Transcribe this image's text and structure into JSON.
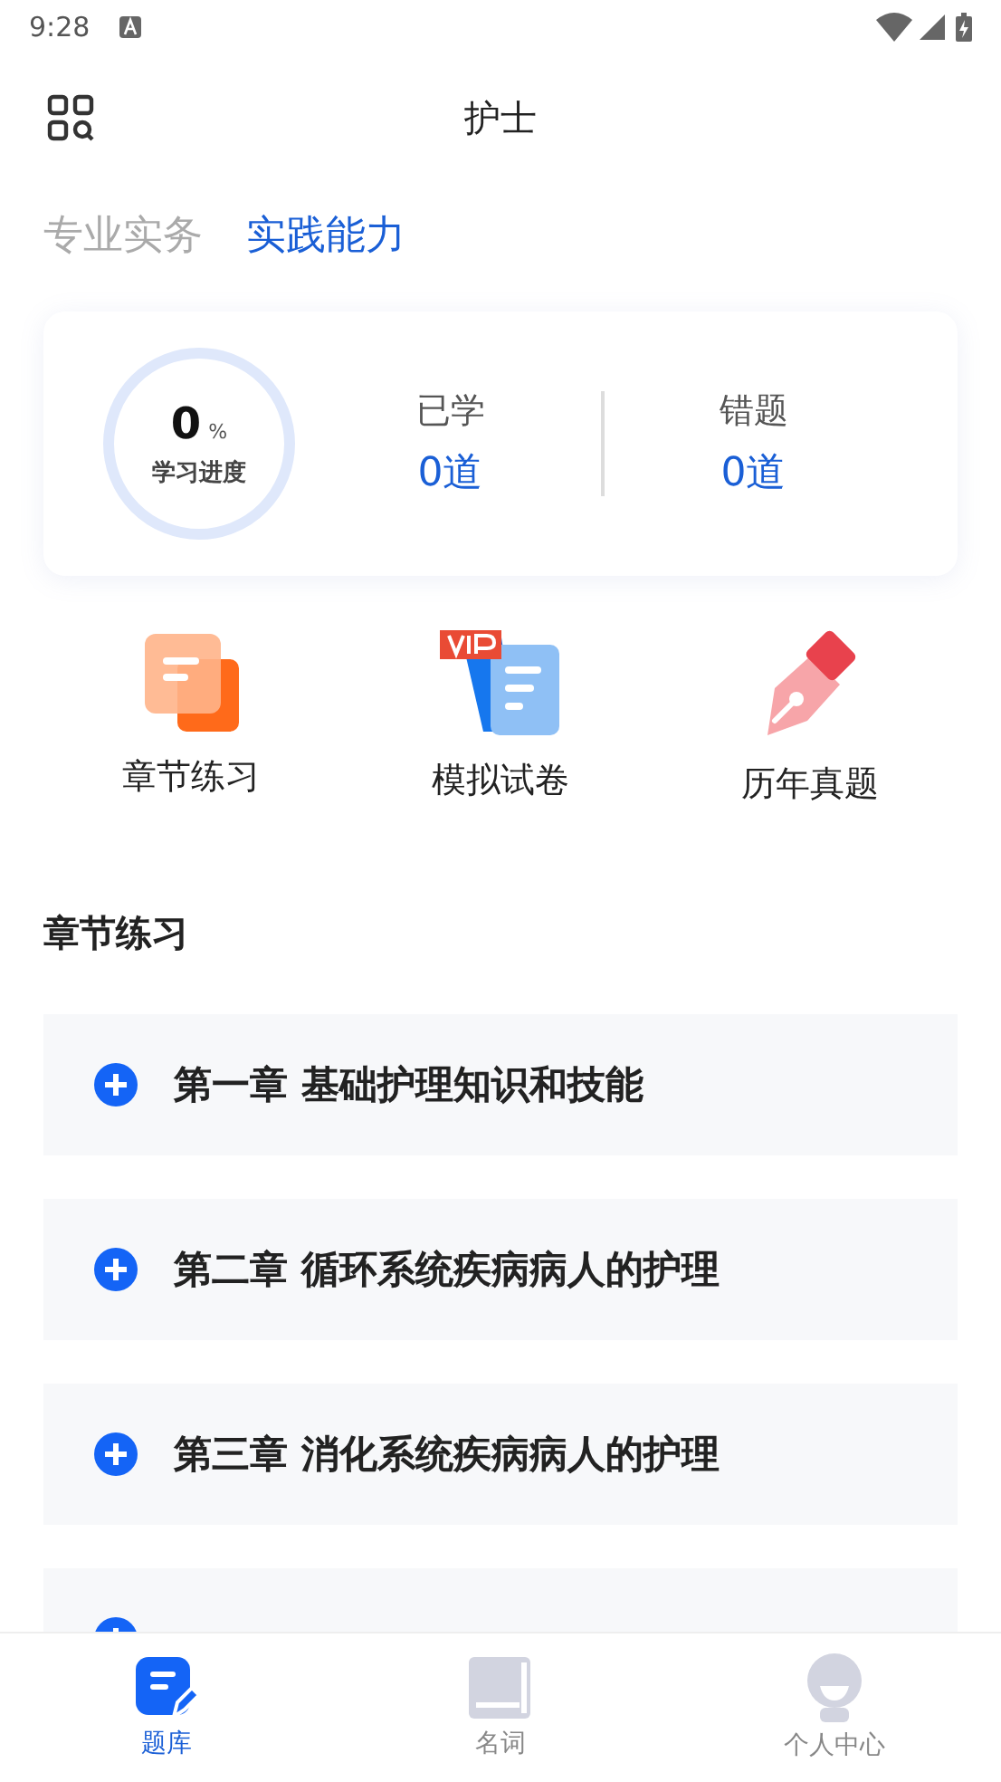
{
  "status_bar": {
    "time": "9:28"
  },
  "header": {
    "title": "护士"
  },
  "tabs": [
    {
      "label": "专业实务",
      "selected": false
    },
    {
      "label": "实践能力",
      "selected": true
    }
  ],
  "progress": {
    "value": "0",
    "unit": "%",
    "label": "学习进度"
  },
  "stats": [
    {
      "label": "已学",
      "value": "0道"
    },
    {
      "label": "错题",
      "value": "0道"
    }
  ],
  "shortcuts": [
    {
      "kind": "chapter",
      "label": "章节练习"
    },
    {
      "kind": "mock",
      "label": "模拟试卷"
    },
    {
      "kind": "past",
      "label": "历年真题"
    }
  ],
  "section_title": "章节练习",
  "chapters": [
    {
      "kind": "chapter",
      "title": "第一章 基础护理知识和技能"
    },
    {
      "kind": "chapter",
      "title": "第二章 循环系统疾病病人的护理"
    },
    {
      "kind": "chapter",
      "title": "第三章 消化系统疾病病人的护理"
    },
    {
      "kind": "partial"
    }
  ],
  "nav": [
    {
      "kind": "bank",
      "label": "题库",
      "selected": true
    },
    {
      "kind": "book",
      "label": "名词",
      "selected": false
    },
    {
      "kind": "person",
      "label": "个人中心",
      "selected": false
    }
  ]
}
